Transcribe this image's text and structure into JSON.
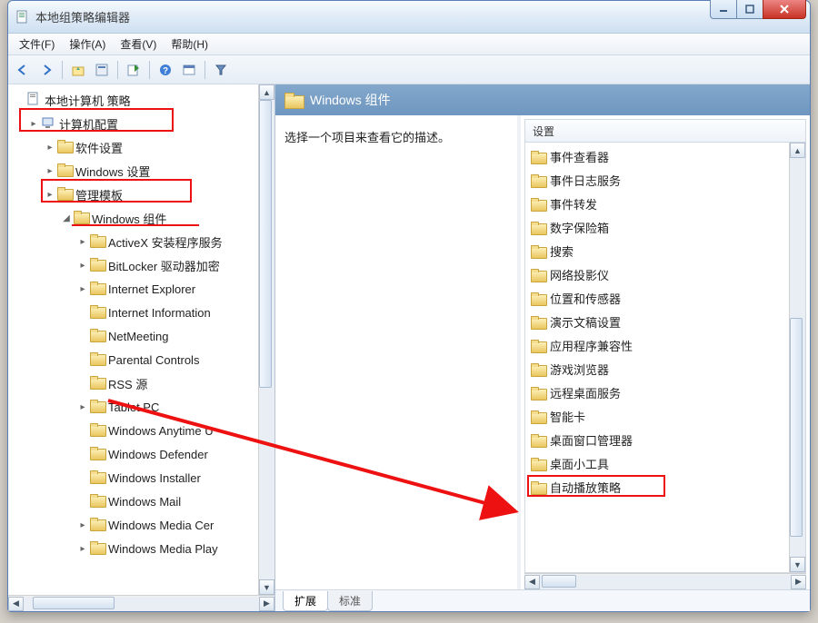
{
  "window": {
    "title": "本地组策略编辑器"
  },
  "menu": {
    "file": "文件(F)",
    "action": "操作(A)",
    "view": "查看(V)",
    "help": "帮助(H)"
  },
  "toolbar_icons": [
    "back",
    "forward",
    "|",
    "up",
    "props",
    "|",
    "export",
    "|",
    "help",
    "console",
    "|",
    "filter"
  ],
  "tree": [
    {
      "ind": 0,
      "exp": "",
      "icon": "doc",
      "label": "本地计算机 策略"
    },
    {
      "ind": 1,
      "exp": "▸",
      "icon": "pc",
      "label": "计算机配置"
    },
    {
      "ind": 2,
      "exp": "▸",
      "icon": "folder",
      "label": "软件设置"
    },
    {
      "ind": 2,
      "exp": "▸",
      "icon": "folder",
      "label": "Windows 设置"
    },
    {
      "ind": 2,
      "exp": "▸",
      "icon": "folder",
      "label": "管理模板"
    },
    {
      "ind": 3,
      "exp": "◢",
      "icon": "folder",
      "label": "Windows 组件"
    },
    {
      "ind": 4,
      "exp": "▸",
      "icon": "folder",
      "label": "ActiveX 安装程序服务"
    },
    {
      "ind": 4,
      "exp": "▸",
      "icon": "folder",
      "label": "BitLocker 驱动器加密"
    },
    {
      "ind": 4,
      "exp": "▸",
      "icon": "folder",
      "label": "Internet Explorer"
    },
    {
      "ind": 4,
      "exp": "",
      "icon": "folder",
      "label": "Internet Information"
    },
    {
      "ind": 4,
      "exp": "",
      "icon": "folder",
      "label": "NetMeeting"
    },
    {
      "ind": 4,
      "exp": "",
      "icon": "folder",
      "label": "Parental Controls"
    },
    {
      "ind": 4,
      "exp": "",
      "icon": "folder",
      "label": "RSS 源"
    },
    {
      "ind": 4,
      "exp": "▸",
      "icon": "folder",
      "label": "Tablet PC"
    },
    {
      "ind": 4,
      "exp": "",
      "icon": "folder",
      "label": "Windows Anytime U"
    },
    {
      "ind": 4,
      "exp": "",
      "icon": "folder",
      "label": "Windows Defender"
    },
    {
      "ind": 4,
      "exp": "",
      "icon": "folder",
      "label": "Windows Installer"
    },
    {
      "ind": 4,
      "exp": "",
      "icon": "folder",
      "label": "Windows Mail"
    },
    {
      "ind": 4,
      "exp": "▸",
      "icon": "folder",
      "label": "Windows Media Cer"
    },
    {
      "ind": 4,
      "exp": "▸",
      "icon": "folder",
      "label": "Windows Media Play"
    }
  ],
  "right": {
    "header": "Windows 组件",
    "desc": "选择一个项目来查看它的描述。",
    "col_header": "设置",
    "items": [
      "事件查看器",
      "事件日志服务",
      "事件转发",
      "数字保险箱",
      "搜索",
      "网络投影仪",
      "位置和传感器",
      "演示文稿设置",
      "应用程序兼容性",
      "游戏浏览器",
      "远程桌面服务",
      "智能卡",
      "桌面窗口管理器",
      "桌面小工具",
      "自动播放策略"
    ],
    "tabs": {
      "active": "扩展",
      "inactive": "标准"
    }
  }
}
